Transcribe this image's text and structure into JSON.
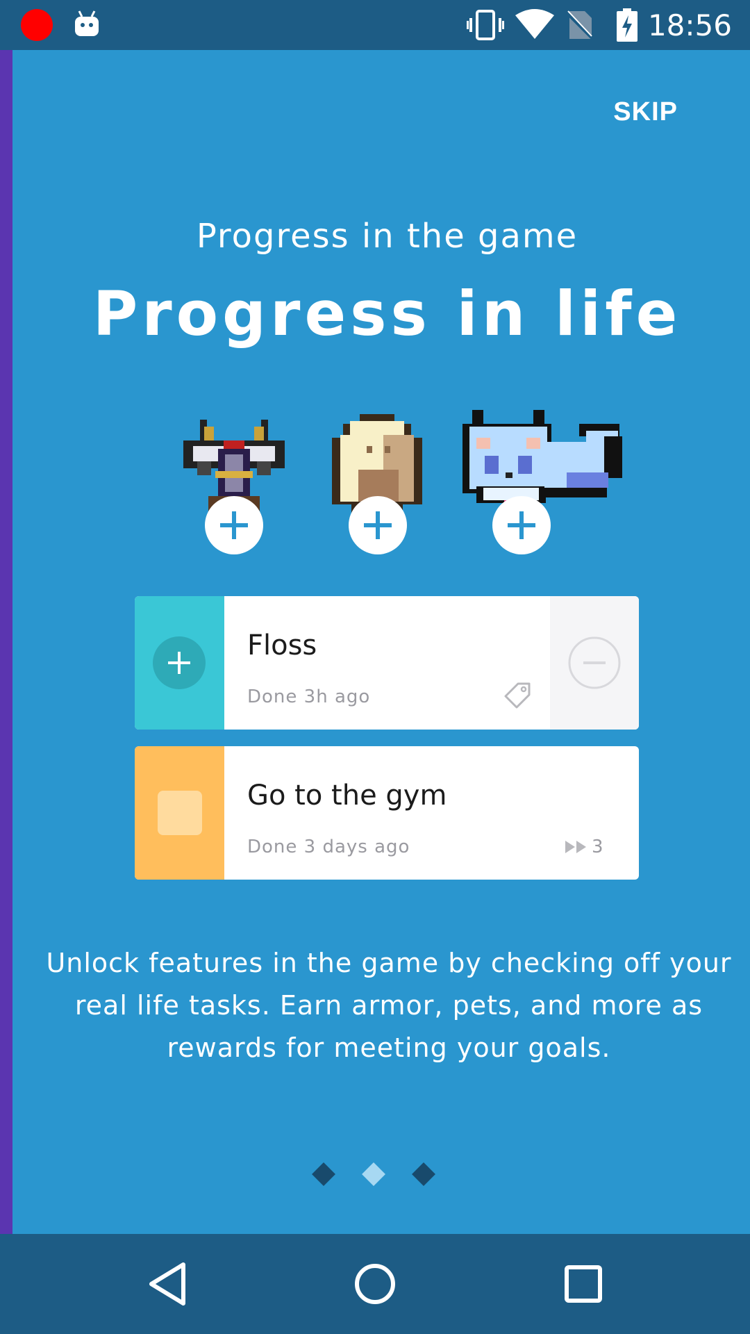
{
  "status_bar": {
    "time": "18:56",
    "icons": [
      "record-dot",
      "android-debug-icon",
      "vibrate-icon",
      "wifi-icon",
      "no-sim-icon",
      "battery-charging-icon"
    ]
  },
  "header": {
    "skip_label": "SKIP"
  },
  "intro": {
    "subtitle": "Progress in the game",
    "title": "Progress in life"
  },
  "rewards": [
    {
      "name": "armor-sprite"
    },
    {
      "name": "egg-sprite"
    },
    {
      "name": "pet-sprite"
    }
  ],
  "tasks": [
    {
      "title": "Floss",
      "meta": "Done 3h ago",
      "type": "habit",
      "accent_color": "#3ac7d6",
      "icon": "tag-icon"
    },
    {
      "title": "Go to the gym",
      "meta": "Done 3 days ago",
      "type": "daily",
      "accent_color": "#ffbe5c",
      "streak": "3",
      "icon": "streak-icon"
    }
  ],
  "description": "Unlock features in the game by checking off your real life tasks. Earn armor, pets, and more as rewards for meeting your goals.",
  "pager": {
    "pages": 3,
    "active": 2
  },
  "colors": {
    "background": "#2a96cf",
    "bars": "#1d5c85",
    "edge": "#5b35b0"
  },
  "nav": {
    "buttons": [
      "back-icon",
      "home-icon",
      "recents-icon"
    ]
  }
}
